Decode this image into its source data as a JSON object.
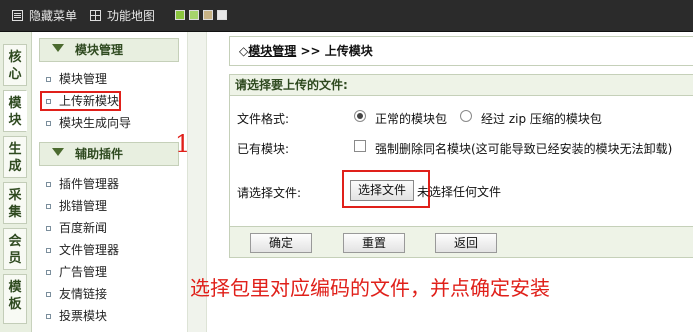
{
  "topbar": {
    "hide_menu": "隐藏菜单",
    "site_map": "功能地图",
    "swatches": [
      "#8bc53f",
      "#a6d46b",
      "#c7b385",
      "#e8e8e8"
    ]
  },
  "tabs": [
    "核心",
    "模块",
    "生成",
    "采集",
    "会员",
    "模板"
  ],
  "menu": {
    "group1_title": "模块管理",
    "group1_items": [
      "模块管理",
      "上传新模块",
      "模块生成向导"
    ],
    "group2_title": "辅助插件",
    "group2_items": [
      "插件管理器",
      "挑错管理",
      "百度新闻",
      "文件管理器",
      "广告管理",
      "友情链接",
      "投票模块"
    ]
  },
  "annotation_number": "1",
  "breadcrumb": {
    "prefix": "◇",
    "link": "模块管理",
    "sep": ">>",
    "current": "上传模块"
  },
  "form": {
    "section_title": "请选择要上传的文件:",
    "format_label": "文件格式:",
    "format_opt1": "正常的模块包",
    "format_opt2": "经过 zip 压缩的模块包",
    "existing_label": "已有模块:",
    "existing_opt": "强制删除同名模块(这可能导致已经安装的模块无法卸载)",
    "file_label": "请选择文件:",
    "file_button": "选择文件",
    "file_none": "未选择任何文件"
  },
  "buttons": {
    "confirm": "确定",
    "reset": "重置",
    "back": "返回"
  },
  "note": "选择包里对应编码的文件，并点确定安装",
  "colors": {
    "accent_red": "#e0201a",
    "menu_green": "#e8efe0",
    "text_green": "#2f4a20"
  }
}
